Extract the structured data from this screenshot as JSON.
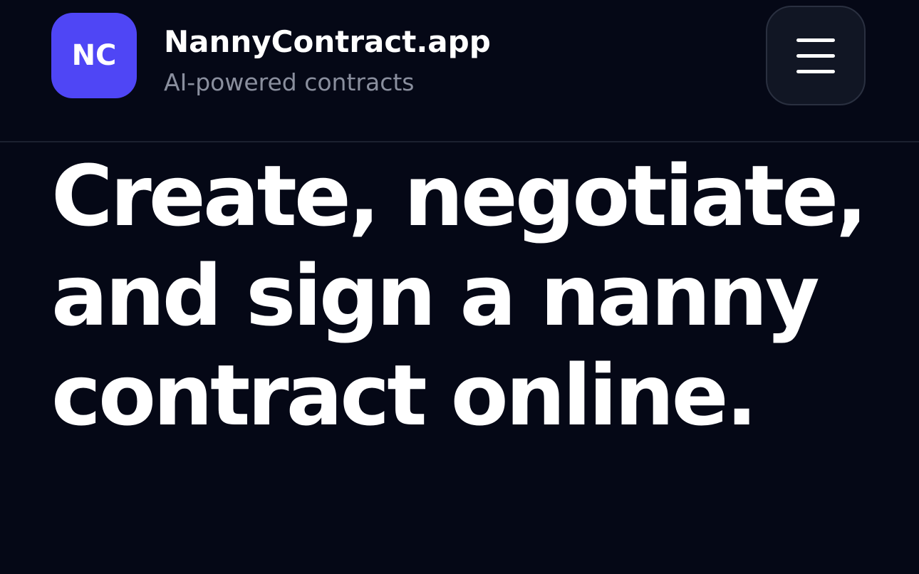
{
  "header": {
    "logo_text": "NC",
    "brand_name": "NannyContract.app",
    "tagline": "AI-powered contracts",
    "menu_icon": "hamburger-menu-icon"
  },
  "hero": {
    "headline": "Create, negotiate, and sign a nanny contract online."
  },
  "colors": {
    "background": "#050816",
    "accent": "#4f46f5",
    "text_primary": "#ffffff",
    "text_secondary": "#8a8f9e",
    "menu_button_bg": "#111624"
  }
}
